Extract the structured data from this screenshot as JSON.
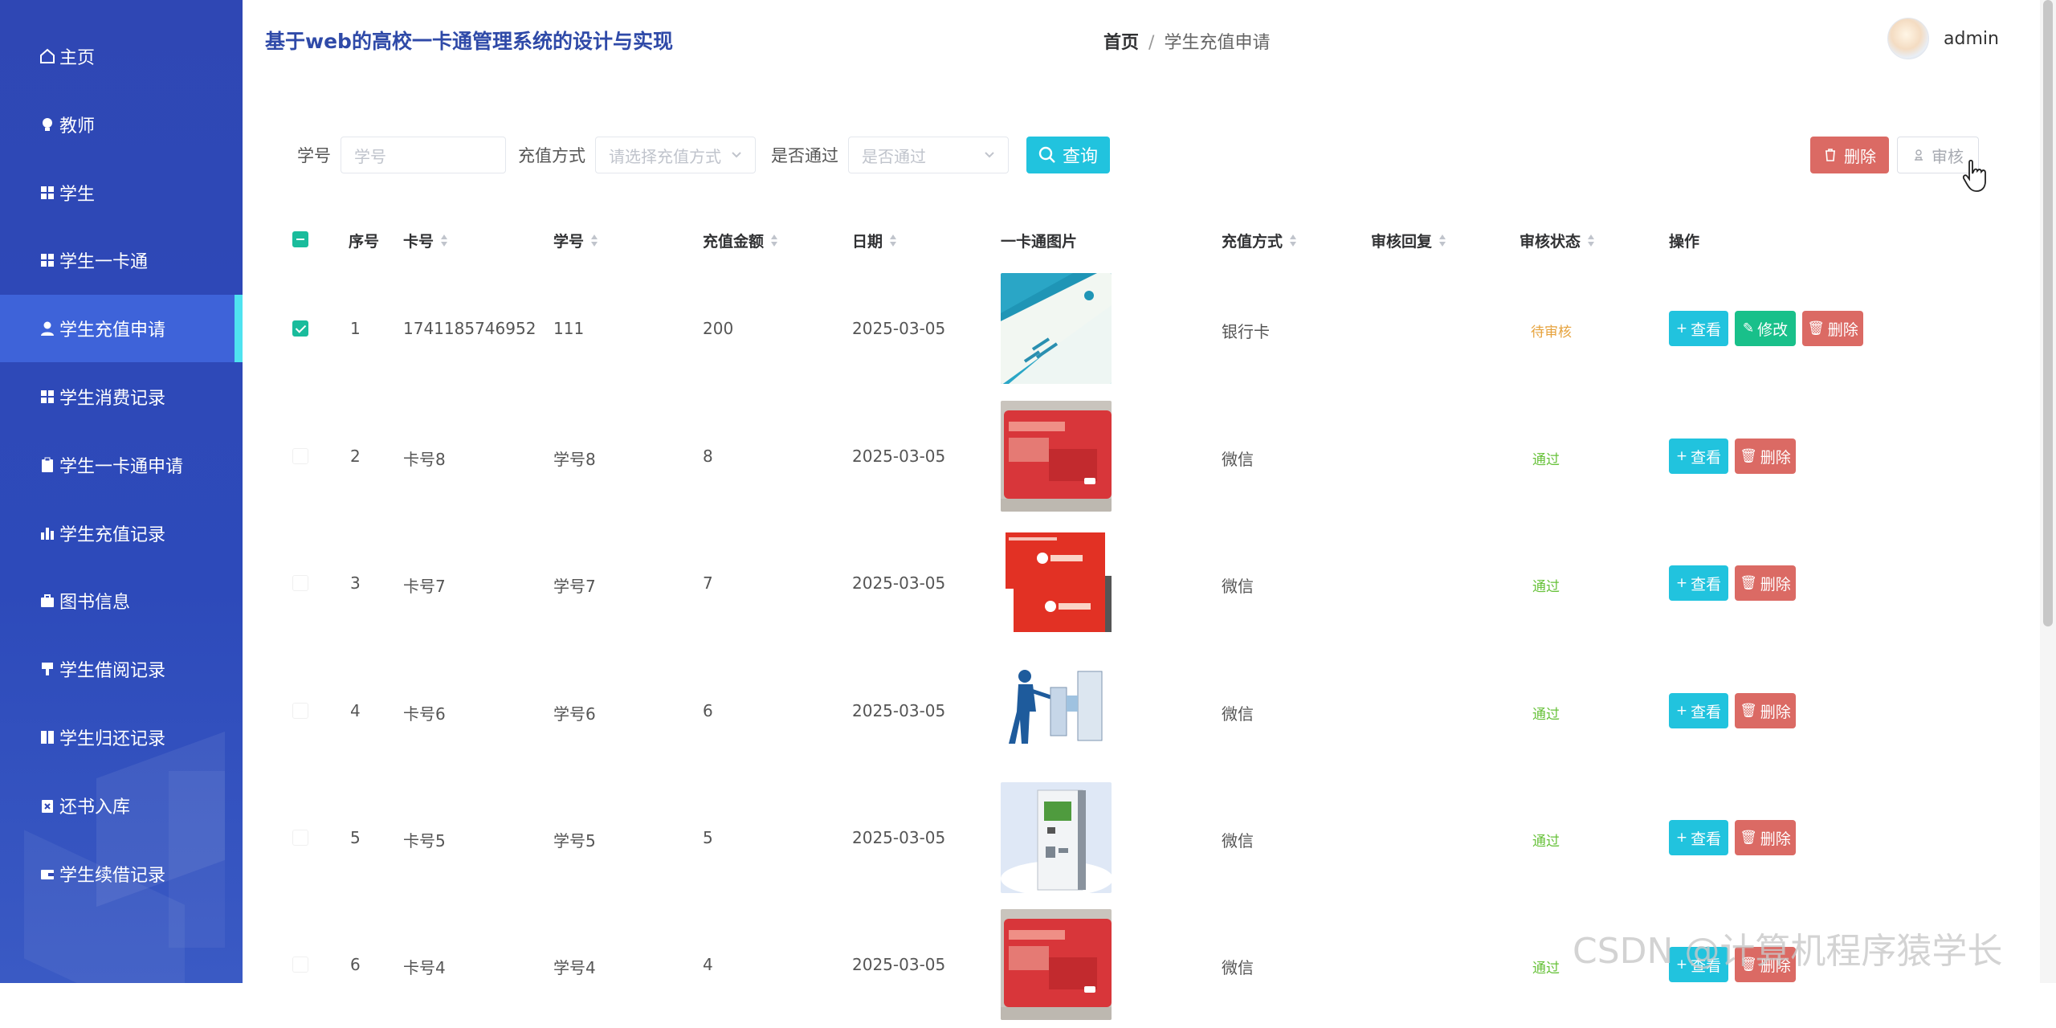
{
  "app": {
    "title": "基于web的高校一卡通管理系统的设计与实现"
  },
  "breadcrumb": {
    "home": "首页",
    "separator": "/",
    "current": "学生充值申请"
  },
  "user": {
    "name": "admin"
  },
  "sidebar": {
    "items": [
      {
        "label": "主页",
        "icon": "home-icon"
      },
      {
        "label": "教师",
        "icon": "bulb-icon"
      },
      {
        "label": "学生",
        "icon": "grid-icon"
      },
      {
        "label": "学生一卡通",
        "icon": "grid-icon"
      },
      {
        "label": "学生充值申请",
        "icon": "user-icon",
        "active": true
      },
      {
        "label": "学生消费记录",
        "icon": "grid-icon"
      },
      {
        "label": "学生一卡通申请",
        "icon": "clipboard-icon"
      },
      {
        "label": "学生充值记录",
        "icon": "bar-chart-icon"
      },
      {
        "label": "图书信息",
        "icon": "briefcase-icon"
      },
      {
        "label": "学生借阅记录",
        "icon": "brush-icon"
      },
      {
        "label": "学生归还记录",
        "icon": "book-icon"
      },
      {
        "label": "还书入库",
        "icon": "clipboard-x-icon"
      },
      {
        "label": "学生续借记录",
        "icon": "wallet-icon"
      }
    ]
  },
  "filters": {
    "student_no": {
      "label": "学号",
      "placeholder": "学号"
    },
    "method": {
      "label": "充值方式",
      "placeholder": "请选择充值方式"
    },
    "passed": {
      "label": "是否通过",
      "placeholder": "是否通过"
    },
    "query_label": "查询",
    "delete_label": "删除",
    "audit_label": "审核"
  },
  "table": {
    "headers": {
      "index": "序号",
      "card_no": "卡号",
      "student_no": "学号",
      "amount": "充值金额",
      "date": "日期",
      "image": "一卡通图片",
      "method": "充值方式",
      "reply": "审核回复",
      "status": "审核状态",
      "actions": "操作"
    },
    "action_labels": {
      "view": "查看",
      "edit": "修改",
      "delete": "删除"
    },
    "rows": [
      {
        "index": "1",
        "card_no": "1741185746952",
        "student_no": "111",
        "amount": "200",
        "date": "2025-03-05",
        "method": "银行卡",
        "reply": "",
        "status": "待审核",
        "status_color": "#e6a23c",
        "checked": true,
        "image": "card-photo-blue",
        "editable": true
      },
      {
        "index": "2",
        "card_no": "卡号8",
        "student_no": "学号8",
        "amount": "8",
        "date": "2025-03-05",
        "method": "微信",
        "reply": "",
        "status": "通过",
        "status_color": "#67c23a",
        "checked": false,
        "image": "card-photo-red-smart",
        "editable": false
      },
      {
        "index": "3",
        "card_no": "卡号7",
        "student_no": "学号7",
        "amount": "7",
        "date": "2025-03-05",
        "method": "微信",
        "reply": "",
        "status": "通过",
        "status_color": "#67c23a",
        "checked": false,
        "image": "card-photo-red-pair",
        "editable": false
      },
      {
        "index": "4",
        "card_no": "卡号6",
        "student_no": "学号6",
        "amount": "6",
        "date": "2025-03-05",
        "method": "微信",
        "reply": "",
        "status": "通过",
        "status_color": "#67c23a",
        "checked": false,
        "image": "turnstile-photo",
        "editable": false
      },
      {
        "index": "5",
        "card_no": "卡号5",
        "student_no": "学号5",
        "amount": "5",
        "date": "2025-03-05",
        "method": "微信",
        "reply": "",
        "status": "通过",
        "status_color": "#67c23a",
        "checked": false,
        "image": "kiosk-photo",
        "editable": false
      },
      {
        "index": "6",
        "card_no": "卡号4",
        "student_no": "学号4",
        "amount": "4",
        "date": "2025-03-05",
        "method": "微信",
        "reply": "",
        "status": "通过",
        "status_color": "#67c23a",
        "checked": false,
        "image": "card-photo-red-smart",
        "editable": false
      }
    ]
  },
  "watermark": "CSDN @计算机程序猿学长",
  "colors": {
    "sidebar": "#2f47b4",
    "sidebar_active": "#3e63d9",
    "active_marker": "#4fe3f0",
    "view_button": "#21c3de",
    "edit_button": "#19c08a",
    "delete_button": "#db6a64",
    "checkbox": "#1abc9c"
  }
}
